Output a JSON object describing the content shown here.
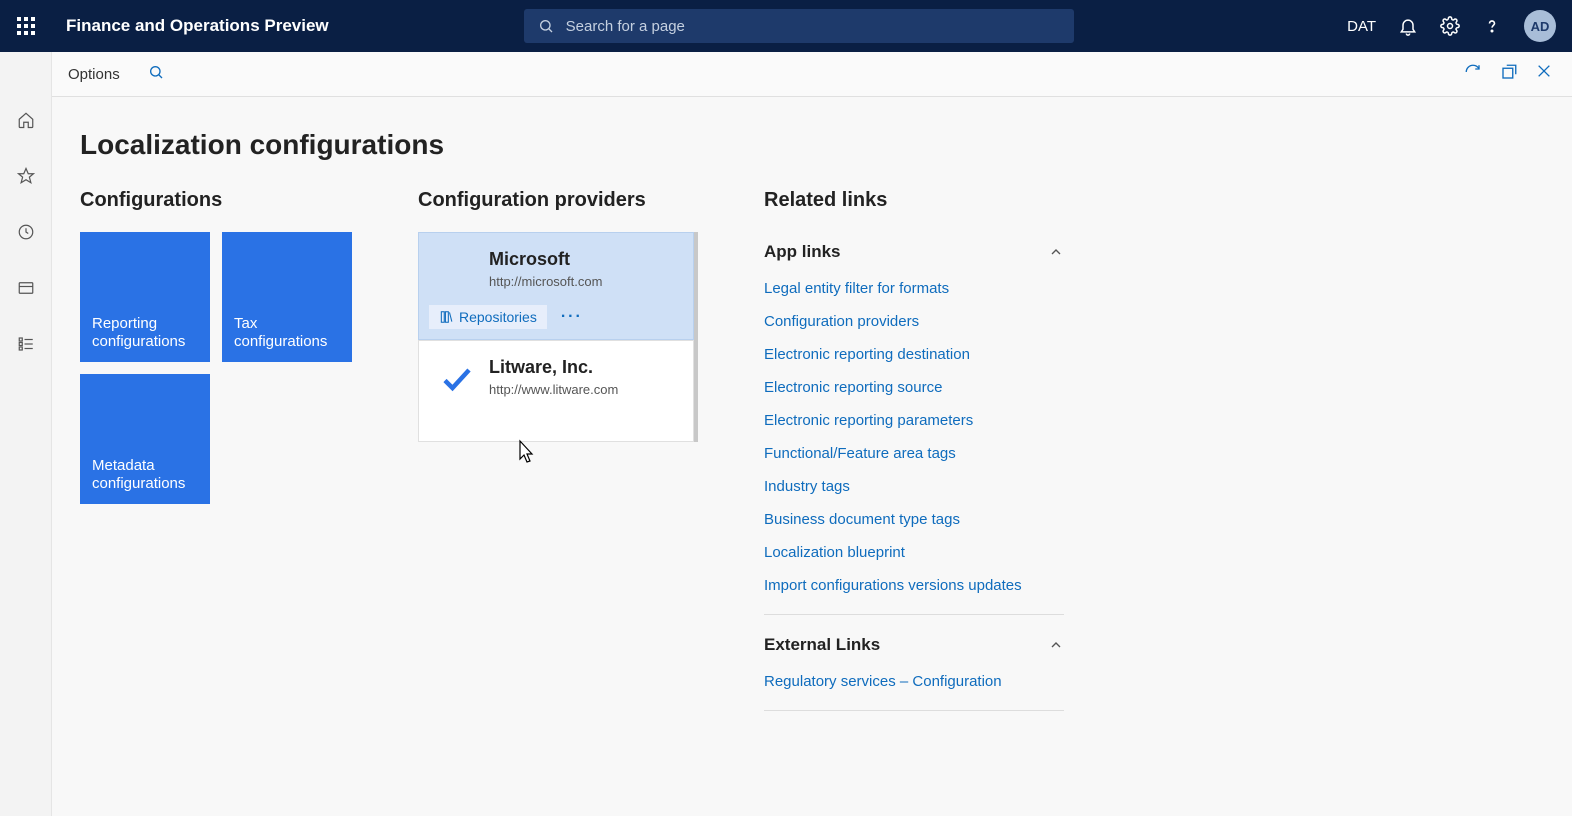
{
  "header": {
    "app_title": "Finance and Operations Preview",
    "search_placeholder": "Search for a page",
    "entity_code": "DAT",
    "avatar_initials": "AD"
  },
  "toolbar": {
    "options_label": "Options"
  },
  "page": {
    "title": "Localization configurations"
  },
  "configurations": {
    "heading": "Configurations",
    "tiles": [
      {
        "label": "Reporting configurations"
      },
      {
        "label": "Tax configurations"
      },
      {
        "label": "Metadata configurations"
      }
    ]
  },
  "providers": {
    "heading": "Configuration providers",
    "repo_button": "Repositories",
    "items": [
      {
        "name": "Microsoft",
        "url": "http://microsoft.com",
        "selected": true,
        "active": false
      },
      {
        "name": "Litware, Inc.",
        "url": "http://www.litware.com",
        "selected": false,
        "active": true
      }
    ]
  },
  "related": {
    "heading": "Related links",
    "groups": [
      {
        "title": "App links",
        "links": [
          "Legal entity filter for formats",
          "Configuration providers",
          "Electronic reporting destination",
          "Electronic reporting source",
          "Electronic reporting parameters",
          "Functional/Feature area tags",
          "Industry tags",
          "Business document type tags",
          "Localization blueprint",
          "Import configurations versions updates"
        ]
      },
      {
        "title": "External Links",
        "links": [
          "Regulatory services – Configuration"
        ]
      }
    ]
  }
}
